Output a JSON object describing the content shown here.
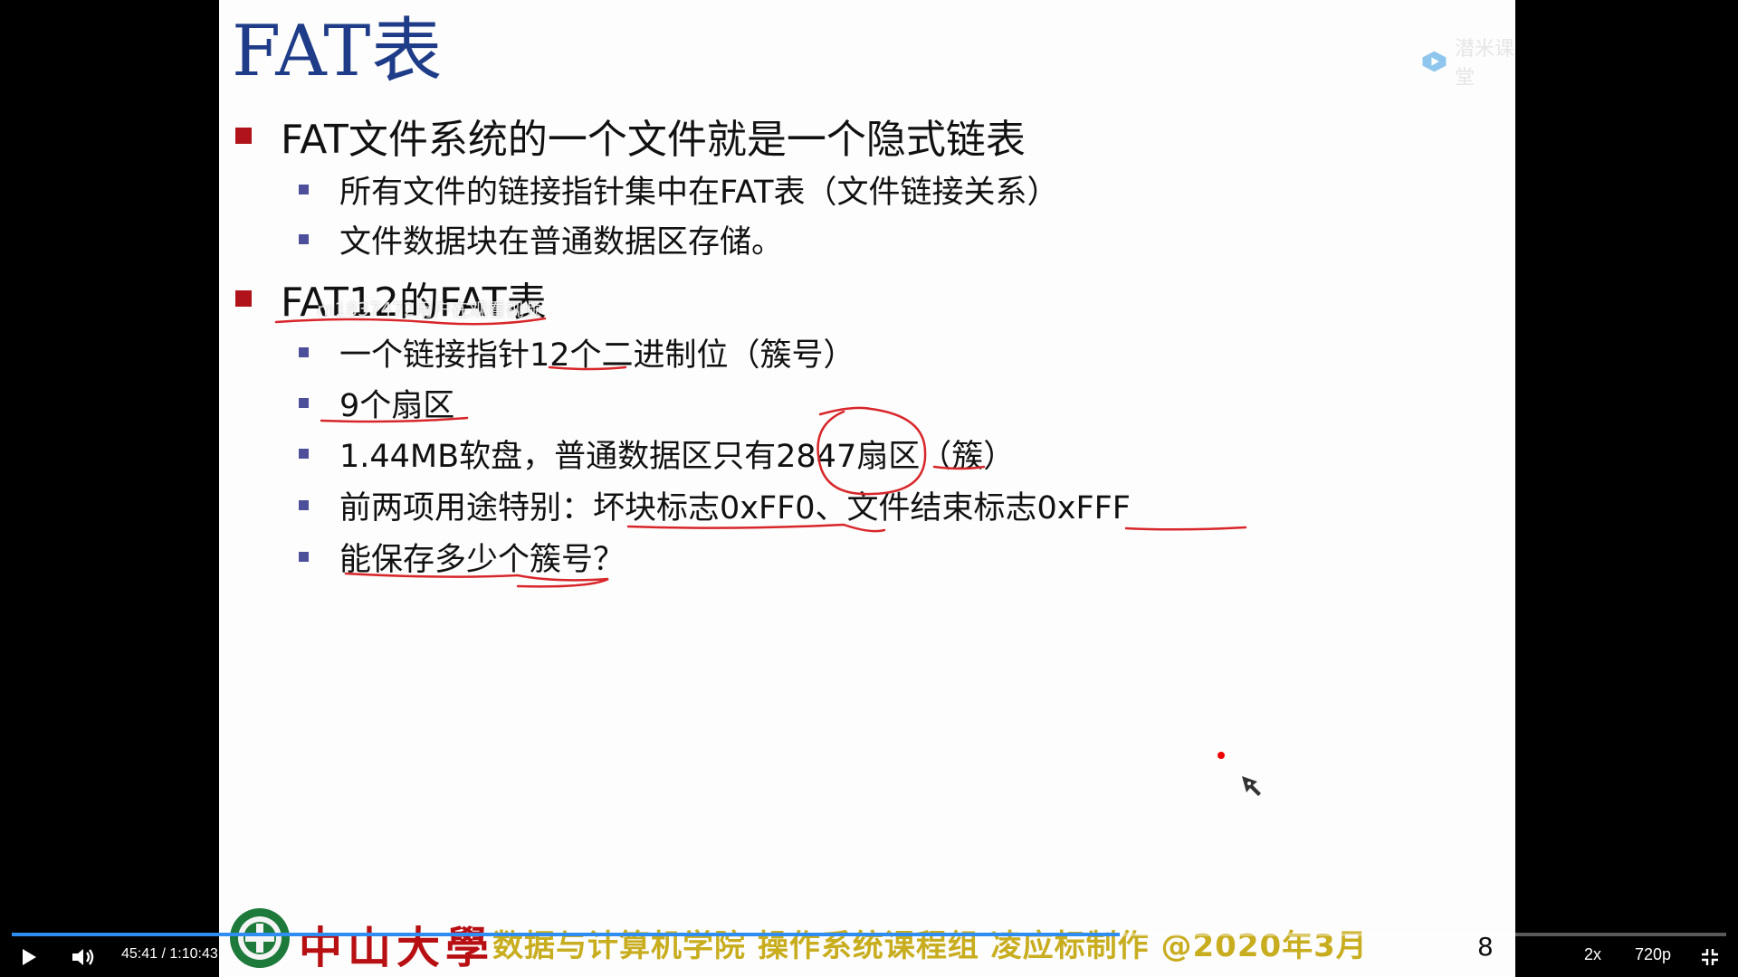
{
  "slide": {
    "title": "FAT表",
    "watermark": "潜米课堂",
    "overlay_user": "m1837472用户在观看视频",
    "bullets": [
      {
        "text": "FAT文件系统的一个文件就是一个隐式链表"
      },
      {
        "text": "所有文件的链接指针集中在FAT表（文件链接关系）"
      },
      {
        "text": "文件数据块在普通数据区存储。"
      },
      {
        "text": "FAT12的FAT表"
      },
      {
        "text": "一个链接指针12个二进制位（簇号）"
      },
      {
        "text": "9个扇区"
      },
      {
        "text": "1.44MB软盘，普通数据区只有2847扇区（簇）"
      },
      {
        "text": "前两项用途特别：坏块标志0xFF0、文件结束标志0xFFF"
      },
      {
        "text": "能保存多少个簇号？"
      }
    ],
    "footer": {
      "university": "中山大學",
      "credit": "数据与计算机学院  操作系统课程组  凌应标制作  @2020年3月",
      "page_number": "8"
    },
    "annotation_color": "#d8262a"
  },
  "player": {
    "current_time": "45:41",
    "separator": " / ",
    "duration": "1:10:43",
    "progress": 0.646,
    "speed": "2x",
    "quality": "720p",
    "icons": {
      "play": "play-icon",
      "volume": "volume-icon",
      "exit_fullscreen": "exit-fullscreen-icon"
    },
    "progress_color": "#2f8cf0"
  }
}
